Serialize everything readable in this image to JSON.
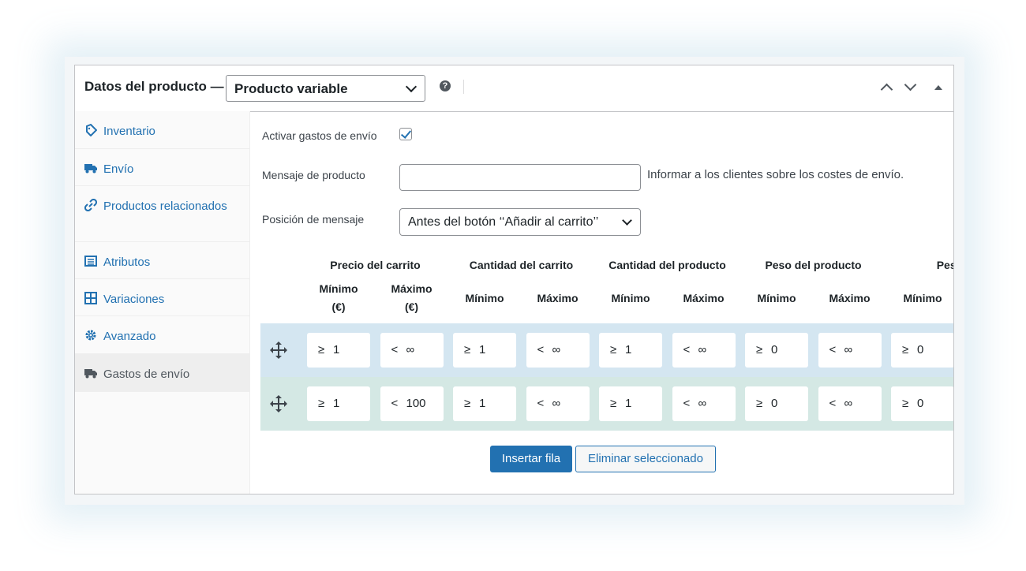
{
  "header": {
    "title": "Datos del producto —",
    "product_type": "Producto variable"
  },
  "sidebar": {
    "items": [
      {
        "label": "Inventario",
        "icon": "tag-icon"
      },
      {
        "label": "Envío",
        "icon": "truck-icon"
      },
      {
        "label": "Productos relacionados",
        "icon": "link-icon"
      },
      {
        "label": "Atributos",
        "icon": "list-icon"
      },
      {
        "label": "Variaciones",
        "icon": "grid-icon"
      },
      {
        "label": "Avanzado",
        "icon": "gear-icon"
      },
      {
        "label": "Gastos de envío",
        "icon": "truck-icon",
        "active": true
      }
    ]
  },
  "form": {
    "enable_label": "Activar gastos de envío",
    "enable_checked": true,
    "message_label": "Mensaje de producto",
    "message_value": "",
    "message_help": "Informar a los clientes sobre los costes de envío.",
    "position_label": "Posición de mensaje",
    "position_value": "Antes del botón ‘‘Añadir al carrito’’"
  },
  "table": {
    "groups": [
      "Precio del carrito",
      "Cantidad del carrito",
      "Cantidad del producto",
      "Peso del producto",
      "Peso del"
    ],
    "sub_headers": [
      "Mínimo (€)",
      "Máximo (€)",
      "Mínimo",
      "Máximo",
      "Mínimo",
      "Máximo",
      "Mínimo",
      "Máximo",
      "Mínimo"
    ],
    "rows": [
      {
        "cells": [
          {
            "op": "≥",
            "val": "1"
          },
          {
            "op": "<",
            "val": "∞"
          },
          {
            "op": "≥",
            "val": "1"
          },
          {
            "op": "<",
            "val": "∞"
          },
          {
            "op": "≥",
            "val": "1"
          },
          {
            "op": "<",
            "val": "∞"
          },
          {
            "op": "≥",
            "val": "0"
          },
          {
            "op": "<",
            "val": "∞"
          },
          {
            "op": "≥",
            "val": "0"
          }
        ]
      },
      {
        "cells": [
          {
            "op": "≥",
            "val": "1"
          },
          {
            "op": "<",
            "val": "100"
          },
          {
            "op": "≥",
            "val": "1"
          },
          {
            "op": "<",
            "val": "∞"
          },
          {
            "op": "≥",
            "val": "1"
          },
          {
            "op": "<",
            "val": "∞"
          },
          {
            "op": "≥",
            "val": "0"
          },
          {
            "op": "<",
            "val": "∞"
          },
          {
            "op": "≥",
            "val": "0"
          }
        ]
      }
    ],
    "row_colors": [
      "#d4e6f1",
      "#d4e8e4"
    ]
  },
  "buttons": {
    "insert": "Insertar fila",
    "delete": "Eliminar seleccionado"
  },
  "colors": {
    "accent": "#2271b1",
    "text": "#1d2327",
    "border": "#c3c4c7"
  }
}
